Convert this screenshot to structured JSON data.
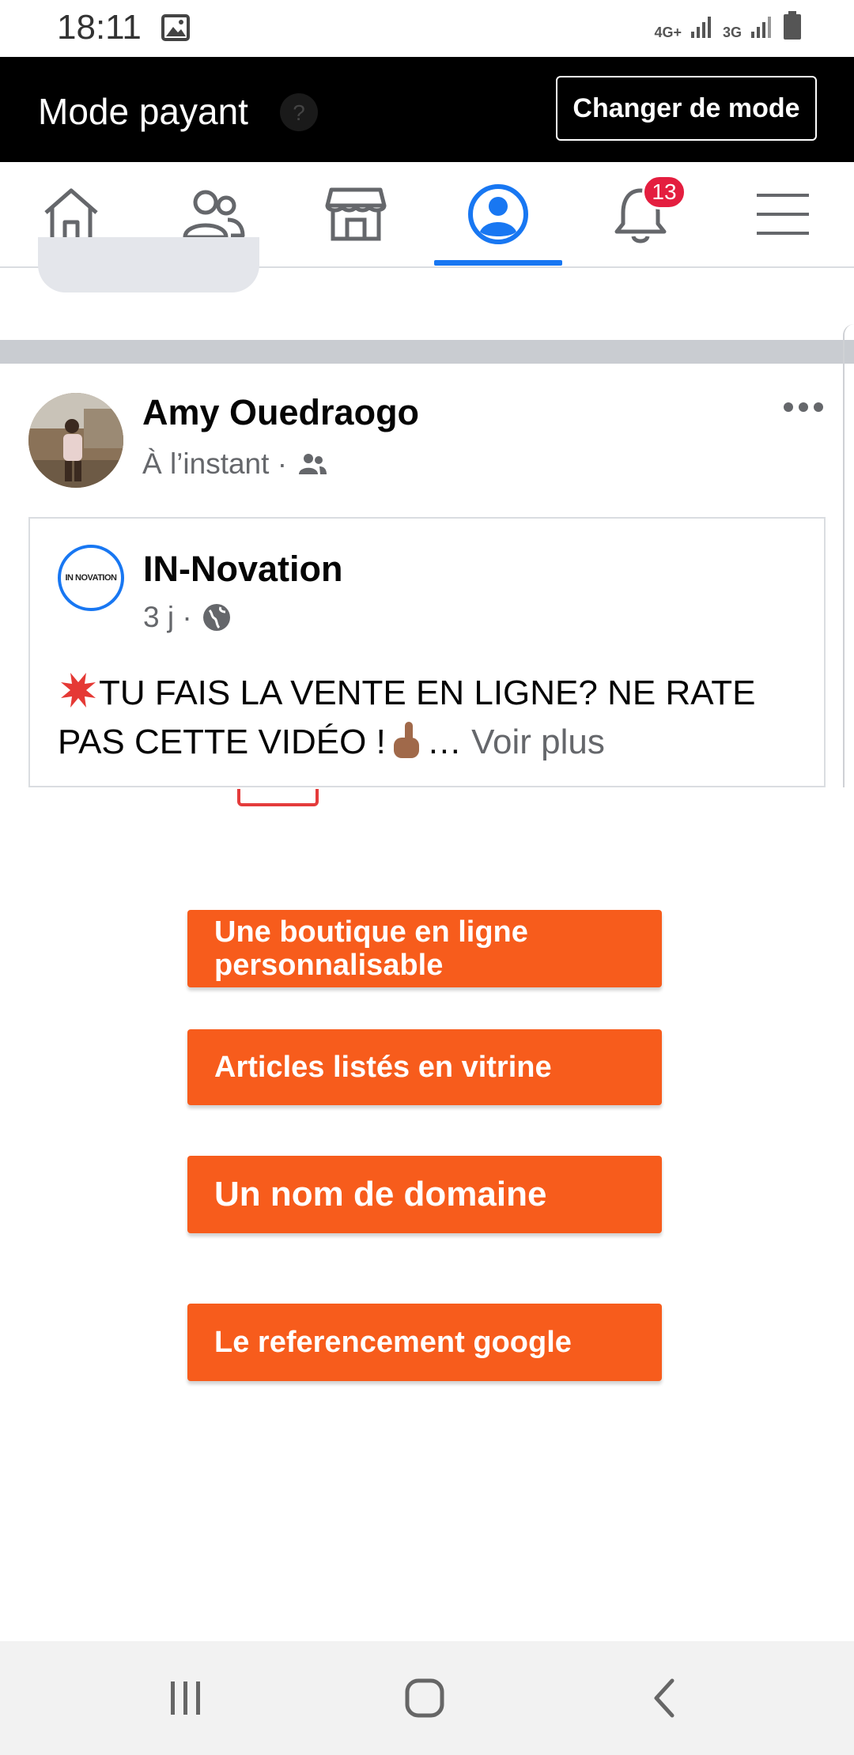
{
  "status_bar": {
    "time": "18:11",
    "network_1": "4G+",
    "network_2": "3G",
    "icons": [
      "image-icon",
      "signal-icon",
      "signal-icon",
      "battery-icon"
    ]
  },
  "mode_bar": {
    "label": "Mode payant",
    "button": "Changer de mode"
  },
  "nav": {
    "items": [
      "home-icon",
      "friends-icon",
      "marketplace-icon",
      "profile-icon",
      "notifications-icon",
      "menu-icon"
    ],
    "active": "profile-icon",
    "notification_count": "13",
    "accent_color": "#1877f2",
    "badge_color": "#e41e3f"
  },
  "post": {
    "author": "Amy Ouedraogo",
    "time": "À l’instant ·",
    "audience_icon": "friends-audience-icon",
    "shared": {
      "page_name": "IN-Novation",
      "page_logo_text": "IN NOVATION",
      "time": "3 j ·",
      "audience_icon": "globe-icon",
      "text": "TU FAIS LA VENTE EN LIGNE? NE RATE PAS CETTE VIDÉO !",
      "ellipsis": "…",
      "see_more": "Voir plus"
    }
  },
  "video": {
    "buttons": [
      {
        "line1": "Une boutique en ligne",
        "line2": "personnalisable"
      },
      {
        "label": "Articles listés en vitrine"
      },
      {
        "label": "Un nom de domaine"
      },
      {
        "label": "Le referencement google"
      }
    ],
    "button_color": "#f75c1c"
  },
  "system_nav": {
    "items": [
      "recent-apps-icon",
      "home-button-icon",
      "back-icon"
    ]
  }
}
